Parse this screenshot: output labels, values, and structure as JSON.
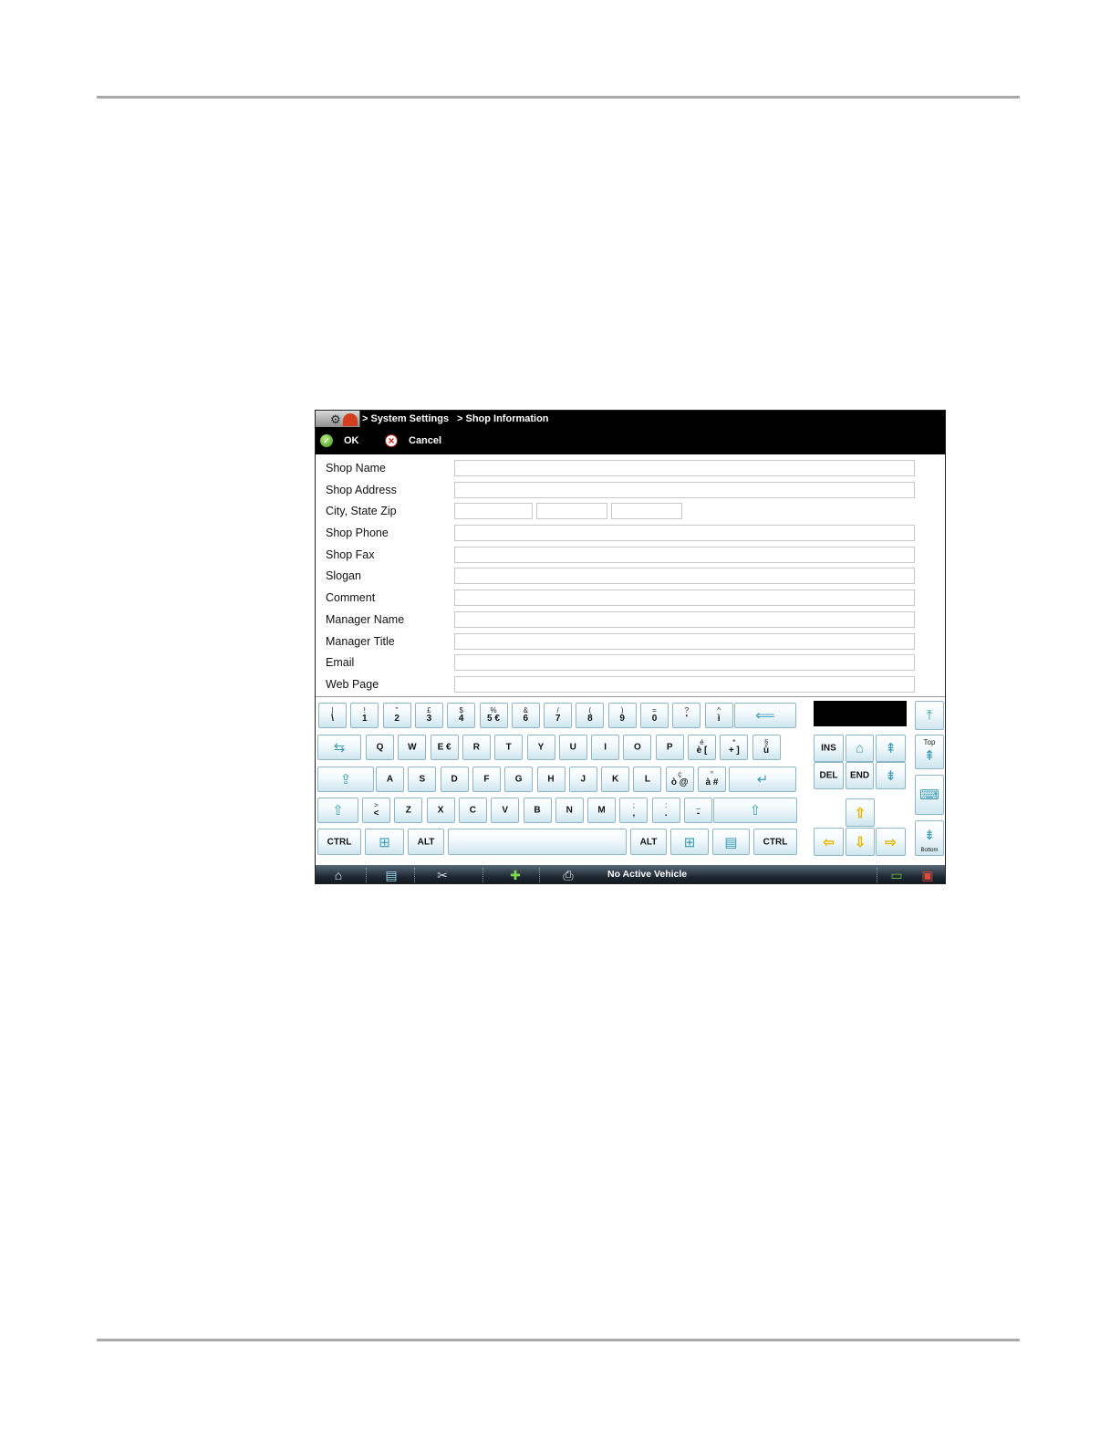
{
  "breadcrumb": {
    "home_icon": "gear-icon",
    "items": [
      "> System Settings",
      "> Shop Information"
    ]
  },
  "toolbar": {
    "ok_label": "OK",
    "cancel_label": "Cancel"
  },
  "form": {
    "labels": [
      "Shop Name",
      "Shop Address",
      "City, State Zip",
      "Shop Phone",
      "Shop Fax",
      "Slogan",
      "Comment",
      "Manager Name",
      "Manager Title",
      "Email",
      "Web Page"
    ],
    "values": [
      "",
      "",
      "",
      "",
      "",
      "",
      "",
      "",
      "",
      "",
      ""
    ],
    "city": "",
    "state": "",
    "zip": ""
  },
  "keyboard": {
    "row1": [
      {
        "s": "|",
        "m": "\\"
      },
      {
        "s": "!",
        "m": "1"
      },
      {
        "s": "\"",
        "m": "2"
      },
      {
        "s": "£",
        "m": "3"
      },
      {
        "s": "$",
        "m": "4"
      },
      {
        "s": "%",
        "m": "5 €"
      },
      {
        "s": "&",
        "m": "6"
      },
      {
        "s": "/",
        "m": "7"
      },
      {
        "s": "(",
        "m": "8"
      },
      {
        "s": ")",
        "m": "9"
      },
      {
        "s": "=",
        "m": "0"
      },
      {
        "s": "?",
        "m": "'"
      },
      {
        "s": "^",
        "m": "ì"
      }
    ],
    "row2": [
      {
        "s": "",
        "m": "Q"
      },
      {
        "s": "",
        "m": "W"
      },
      {
        "s": "",
        "m": "E €"
      },
      {
        "s": "",
        "m": "R"
      },
      {
        "s": "",
        "m": "T"
      },
      {
        "s": "",
        "m": "Y"
      },
      {
        "s": "",
        "m": "U"
      },
      {
        "s": "",
        "m": "I"
      },
      {
        "s": "",
        "m": "O"
      },
      {
        "s": "",
        "m": "P"
      },
      {
        "s": "é",
        "m": "è ["
      },
      {
        "s": "*",
        "m": "+ ]"
      },
      {
        "s": "§",
        "m": "ù"
      }
    ],
    "row3": [
      {
        "s": "",
        "m": "A"
      },
      {
        "s": "",
        "m": "S"
      },
      {
        "s": "",
        "m": "D"
      },
      {
        "s": "",
        "m": "F"
      },
      {
        "s": "",
        "m": "G"
      },
      {
        "s": "",
        "m": "H"
      },
      {
        "s": "",
        "m": "J"
      },
      {
        "s": "",
        "m": "K"
      },
      {
        "s": "",
        "m": "L"
      },
      {
        "s": "ç",
        "m": "ò @"
      },
      {
        "s": "°",
        "m": "à #"
      }
    ],
    "row4": [
      {
        "s": ">",
        "m": "<"
      },
      {
        "s": "",
        "m": "Z"
      },
      {
        "s": "",
        "m": "X"
      },
      {
        "s": "",
        "m": "C"
      },
      {
        "s": "",
        "m": "V"
      },
      {
        "s": "",
        "m": "B"
      },
      {
        "s": "",
        "m": "N"
      },
      {
        "s": "",
        "m": "M"
      },
      {
        "s": ";",
        "m": ","
      },
      {
        "s": ":",
        "m": "."
      },
      {
        "s": "_",
        "m": "-"
      }
    ],
    "ctrl": "CTRL",
    "alt": "ALT",
    "ins": "INS",
    "del": "DEL",
    "end": "END",
    "top": "Top",
    "bottom": "Bottom"
  },
  "taskbar": {
    "status": "No Active Vehicle"
  },
  "colors": {
    "key_border": "#8fb6c6",
    "accent": "#3a9ab3",
    "arrow": "#e6b800"
  }
}
